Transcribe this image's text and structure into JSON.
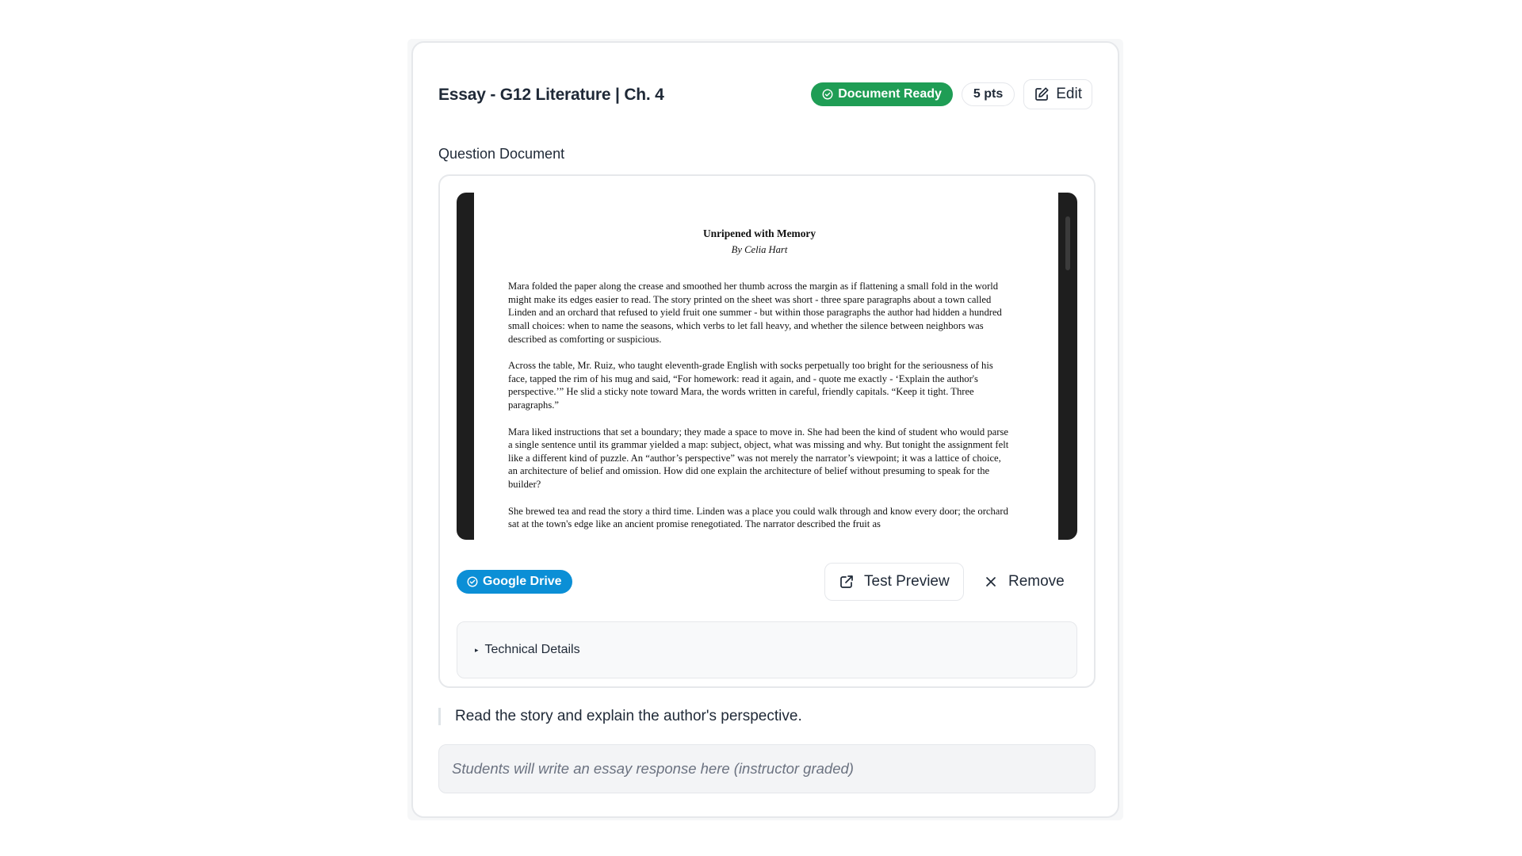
{
  "card": {
    "title": "Essay - G12 Literature | Ch. 4",
    "status_badge": "Document Ready",
    "points_badge": "5 pts",
    "edit_label": "Edit"
  },
  "question_document": {
    "section_label": "Question Document",
    "story": {
      "title": "Unripened with Memory",
      "author": "By Celia Hart",
      "paragraphs": [
        "Mara folded the paper along the crease and smoothed her thumb across the margin as if flattening a small fold in the world might make its edges easier to read. The story printed on the sheet was short - three spare paragraphs about a town called Linden and an orchard that refused to yield fruit one summer - but within those paragraphs the author had hidden a hundred small choices: when to name the seasons, which verbs to let fall heavy, and whether the silence between neighbors was described as comforting or suspicious.",
        "Across the table, Mr. Ruiz, who taught eleventh-grade English with socks perpetually too bright for the seriousness of his face, tapped the rim of his mug and said, “For homework: read it again, and - quote me exactly - ‘Explain the author's perspective.’” He slid a sticky note toward Mara, the words written in careful, friendly capitals. “Keep it tight. Three paragraphs.”",
        "Mara liked instructions that set a boundary; they made a space to move in. She had been the kind of student who would parse a single sentence until its grammar yielded a map: subject, object, what was missing and why. But tonight the assignment felt like a different kind of puzzle. An “author’s perspective” was not merely the narrator’s viewpoint; it was a lattice of choice, an architecture of belief and omission. How did one explain the architecture of belief without presuming to speak for the builder?",
        "She brewed tea and read the story a third time. Linden was a place you could walk through and know every door; the orchard sat at the town's edge like an ancient promise renegotiated. The narrator described the fruit as"
      ]
    },
    "source_badge": "Google Drive",
    "test_preview_label": "Test Preview",
    "remove_label": "Remove",
    "technical_details_label": "Technical Details"
  },
  "prompt_text": "Read the story and explain the author's perspective.",
  "response_placeholder": "Students will write an essay response here (instructor graded)",
  "icons": {
    "status": "check-circle-icon",
    "edit": "edit-icon",
    "source": "check-circle-icon",
    "preview": "external-link-icon",
    "remove": "close-icon",
    "disclosure": "caret-right-icon"
  },
  "colors": {
    "ready_green": "#1f9d55",
    "drive_blue": "#0b8fd6",
    "viewer_dark": "#1e1e1e"
  }
}
